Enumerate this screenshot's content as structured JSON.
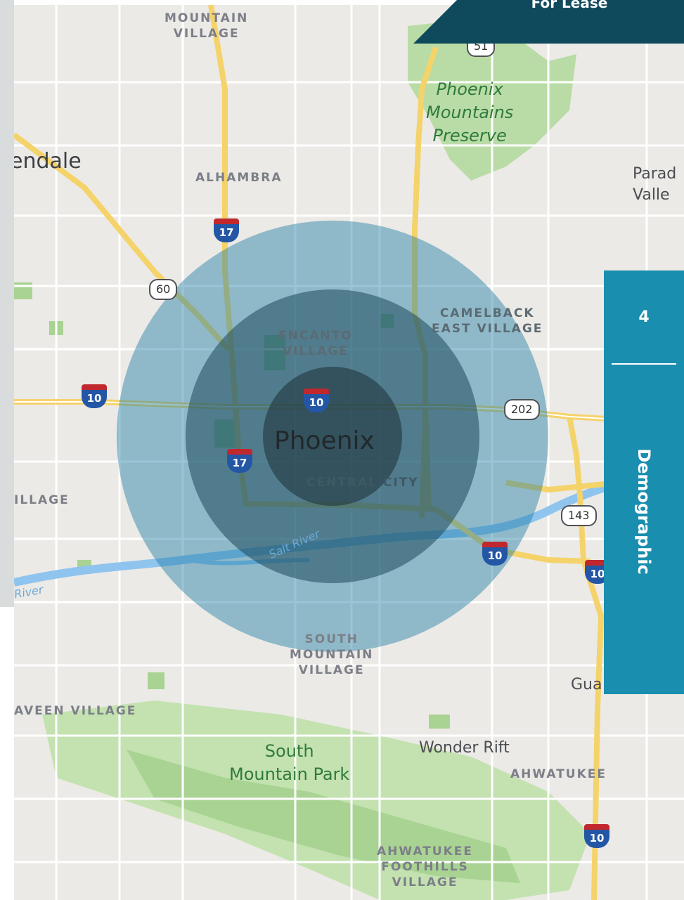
{
  "banner": {
    "text": "For Lease",
    "color": "#0f4a5c"
  },
  "side_tab": {
    "number": "4",
    "label": "Demographic",
    "color": "#1a8eaf"
  },
  "map": {
    "districts": {
      "mountain_village_north": "MOUNTAIN\nVILLAGE",
      "alhambra": "ALHAMBRA",
      "encanto": "ENCANTO\nVILLAGE",
      "camelback": "CAMELBACK\nEAST VILLAGE",
      "central_city": "CENTRAL CITY",
      "village_west": "ILLAGE",
      "south_mountain_village": "SOUTH\nMOUNTAIN\nVILLAGE",
      "laveen": "AVEEN VILLAGE",
      "ahwatukee": "AHWATUKEE",
      "ahwatukee_foothills": "AHWATUKEE\nFOOTHILLS\nVILLAGE"
    },
    "cities": {
      "glendale": "endale",
      "phoenix": "Phoenix",
      "paradise_valley": "Parad\nValle",
      "guadalupe": "Gua",
      "wonder_rift": "Wonder Rift"
    },
    "parks": {
      "phoenix_mountains": "Phoenix\nMountains\nPreserve",
      "south_mountain": "South\nMountain Park"
    },
    "water": {
      "salt_river": "Salt River",
      "river_west": "River"
    },
    "shields": {
      "i17_north": "17",
      "i17_south": "17",
      "i10_west": "10",
      "i10_center": "10",
      "i10_east": "10",
      "i10_far_east": "10",
      "i10_south": "10",
      "us60": "60",
      "sr51": "51",
      "sr202": "202",
      "sr143": "143"
    },
    "rings": {
      "count": 3,
      "colors": [
        "#1e7ea6",
        "#1d4b5b",
        "#1c2f36"
      ]
    }
  }
}
